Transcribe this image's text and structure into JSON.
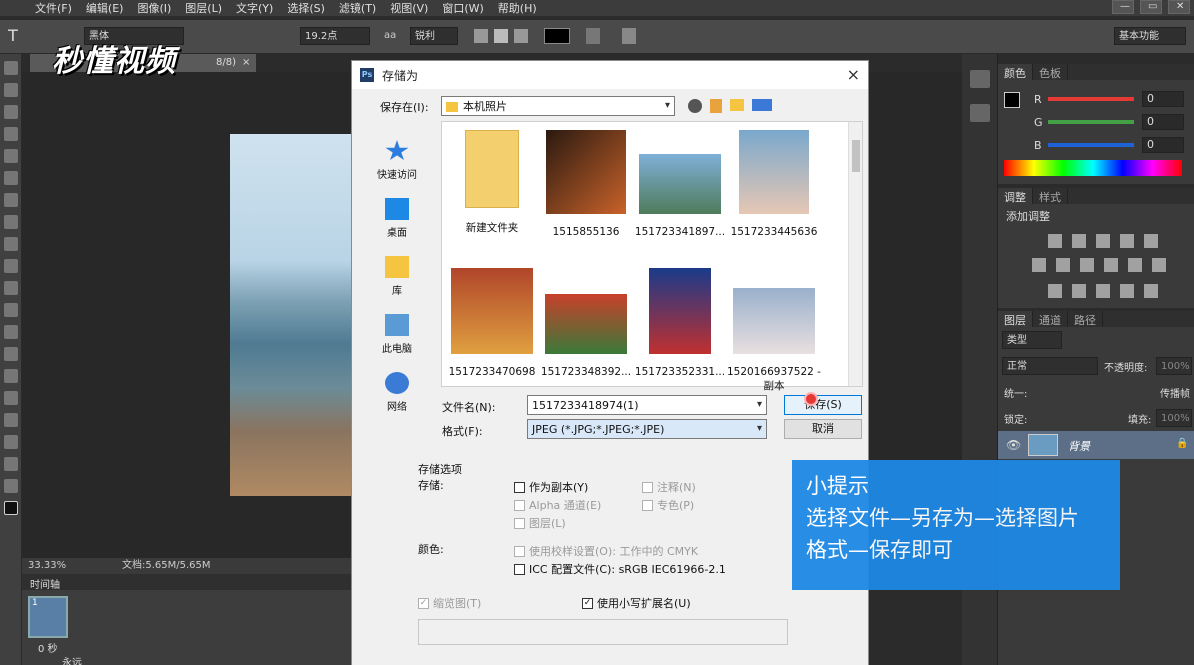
{
  "menu": {
    "items": [
      "文件(F)",
      "编辑(E)",
      "图像(I)",
      "图层(L)",
      "文字(Y)",
      "选择(S)",
      "滤镜(T)",
      "视图(V)",
      "窗口(W)",
      "帮助(H)"
    ],
    "window_controls": [
      "—",
      "▭",
      "✕"
    ]
  },
  "options_bar": {
    "font_family": "黑体",
    "font_size": "19.2点",
    "aa_label": "aa",
    "aa_mode": "锐利",
    "workspace": "基本功能"
  },
  "watermark_logo": "秒懂视频",
  "doc_tab": {
    "suffix": "8/8)",
    "close": "×"
  },
  "status": {
    "zoom": "33.33%",
    "doc_size": "文档:5.65M/5.65M"
  },
  "timeline": {
    "label": "时间轴",
    "frame_time": "0 秒",
    "loop": "永远",
    "frame_num": "1"
  },
  "color_panel": {
    "tabs": [
      "颜色",
      "色板"
    ],
    "channels": [
      {
        "label": "R",
        "value": "0",
        "color": "#e53935"
      },
      {
        "label": "G",
        "value": "0",
        "color": "#43a047"
      },
      {
        "label": "B",
        "value": "0",
        "color": "#1e63d6"
      }
    ]
  },
  "adjust_panel": {
    "tabs": [
      "调整",
      "样式"
    ],
    "title": "添加调整"
  },
  "layers_panel": {
    "tabs": [
      "图层",
      "通道",
      "路径"
    ],
    "filter": "类型",
    "blend_mode": "正常",
    "opacity_label": "不透明度:",
    "opacity_value": "100%",
    "unify_label": "统一:",
    "propagate_label": "传播帧",
    "lock_label": "锁定:",
    "fill_label": "填充:",
    "fill_value": "100%",
    "layer_name": "背景"
  },
  "dialog": {
    "title": "存储为",
    "close": "×",
    "save_in_label": "保存在(I):",
    "save_in_value": "本机照片",
    "places": [
      "快速访问",
      "桌面",
      "库",
      "此电脑",
      "网络"
    ],
    "files": [
      {
        "name": "新建文件夹",
        "kind": "folder"
      },
      {
        "name": "1515855136",
        "kind": "photo",
        "colors": [
          "#2a1a10",
          "#c9622a"
        ]
      },
      {
        "name": "151723341897...",
        "kind": "photo",
        "colors": [
          "#7fb0d8",
          "#4f7b5a"
        ]
      },
      {
        "name": "1517233445636",
        "kind": "photo",
        "colors": [
          "#7aa8cc",
          "#e6c7b4"
        ]
      },
      {
        "name": "1517233470698",
        "kind": "photo",
        "colors": [
          "#b0452a",
          "#e0a040"
        ]
      },
      {
        "name": "151723348392...",
        "kind": "photo",
        "colors": [
          "#c8402a",
          "#3a7a3a"
        ]
      },
      {
        "name": "151723352331...",
        "kind": "photo",
        "colors": [
          "#1a3a8a",
          "#c03030"
        ]
      },
      {
        "name": "1520166937522 - 副本",
        "kind": "photo",
        "colors": [
          "#9ab0cc",
          "#e8e0e0"
        ]
      }
    ],
    "filename_label": "文件名(N):",
    "filename_value": "1517233418974(1)",
    "format_label": "格式(F):",
    "format_value": "JPEG (*.JPG;*.JPEG;*.JPE)",
    "save_button": "保存(S)",
    "cancel_button": "取消",
    "options_title": "存储选项",
    "storage_label": "存储:",
    "color_label": "颜色:",
    "checks": {
      "as_copy": "作为副本(Y)",
      "notes": "注释(N)",
      "alpha": "Alpha 通道(E)",
      "spot": "专色(P)",
      "layers": "图层(L)",
      "proof": "使用校样设置(O): 工作中的 CMYK",
      "icc": "ICC 配置文件(C): sRGB IEC61966-2.1",
      "thumbnail": "缩览图(T)",
      "lowercase": "使用小写扩展名(U)"
    }
  },
  "tip": {
    "title": "小提示",
    "line1": "选择文件—另存为—选择图片",
    "line2": "格式—保存即可"
  }
}
